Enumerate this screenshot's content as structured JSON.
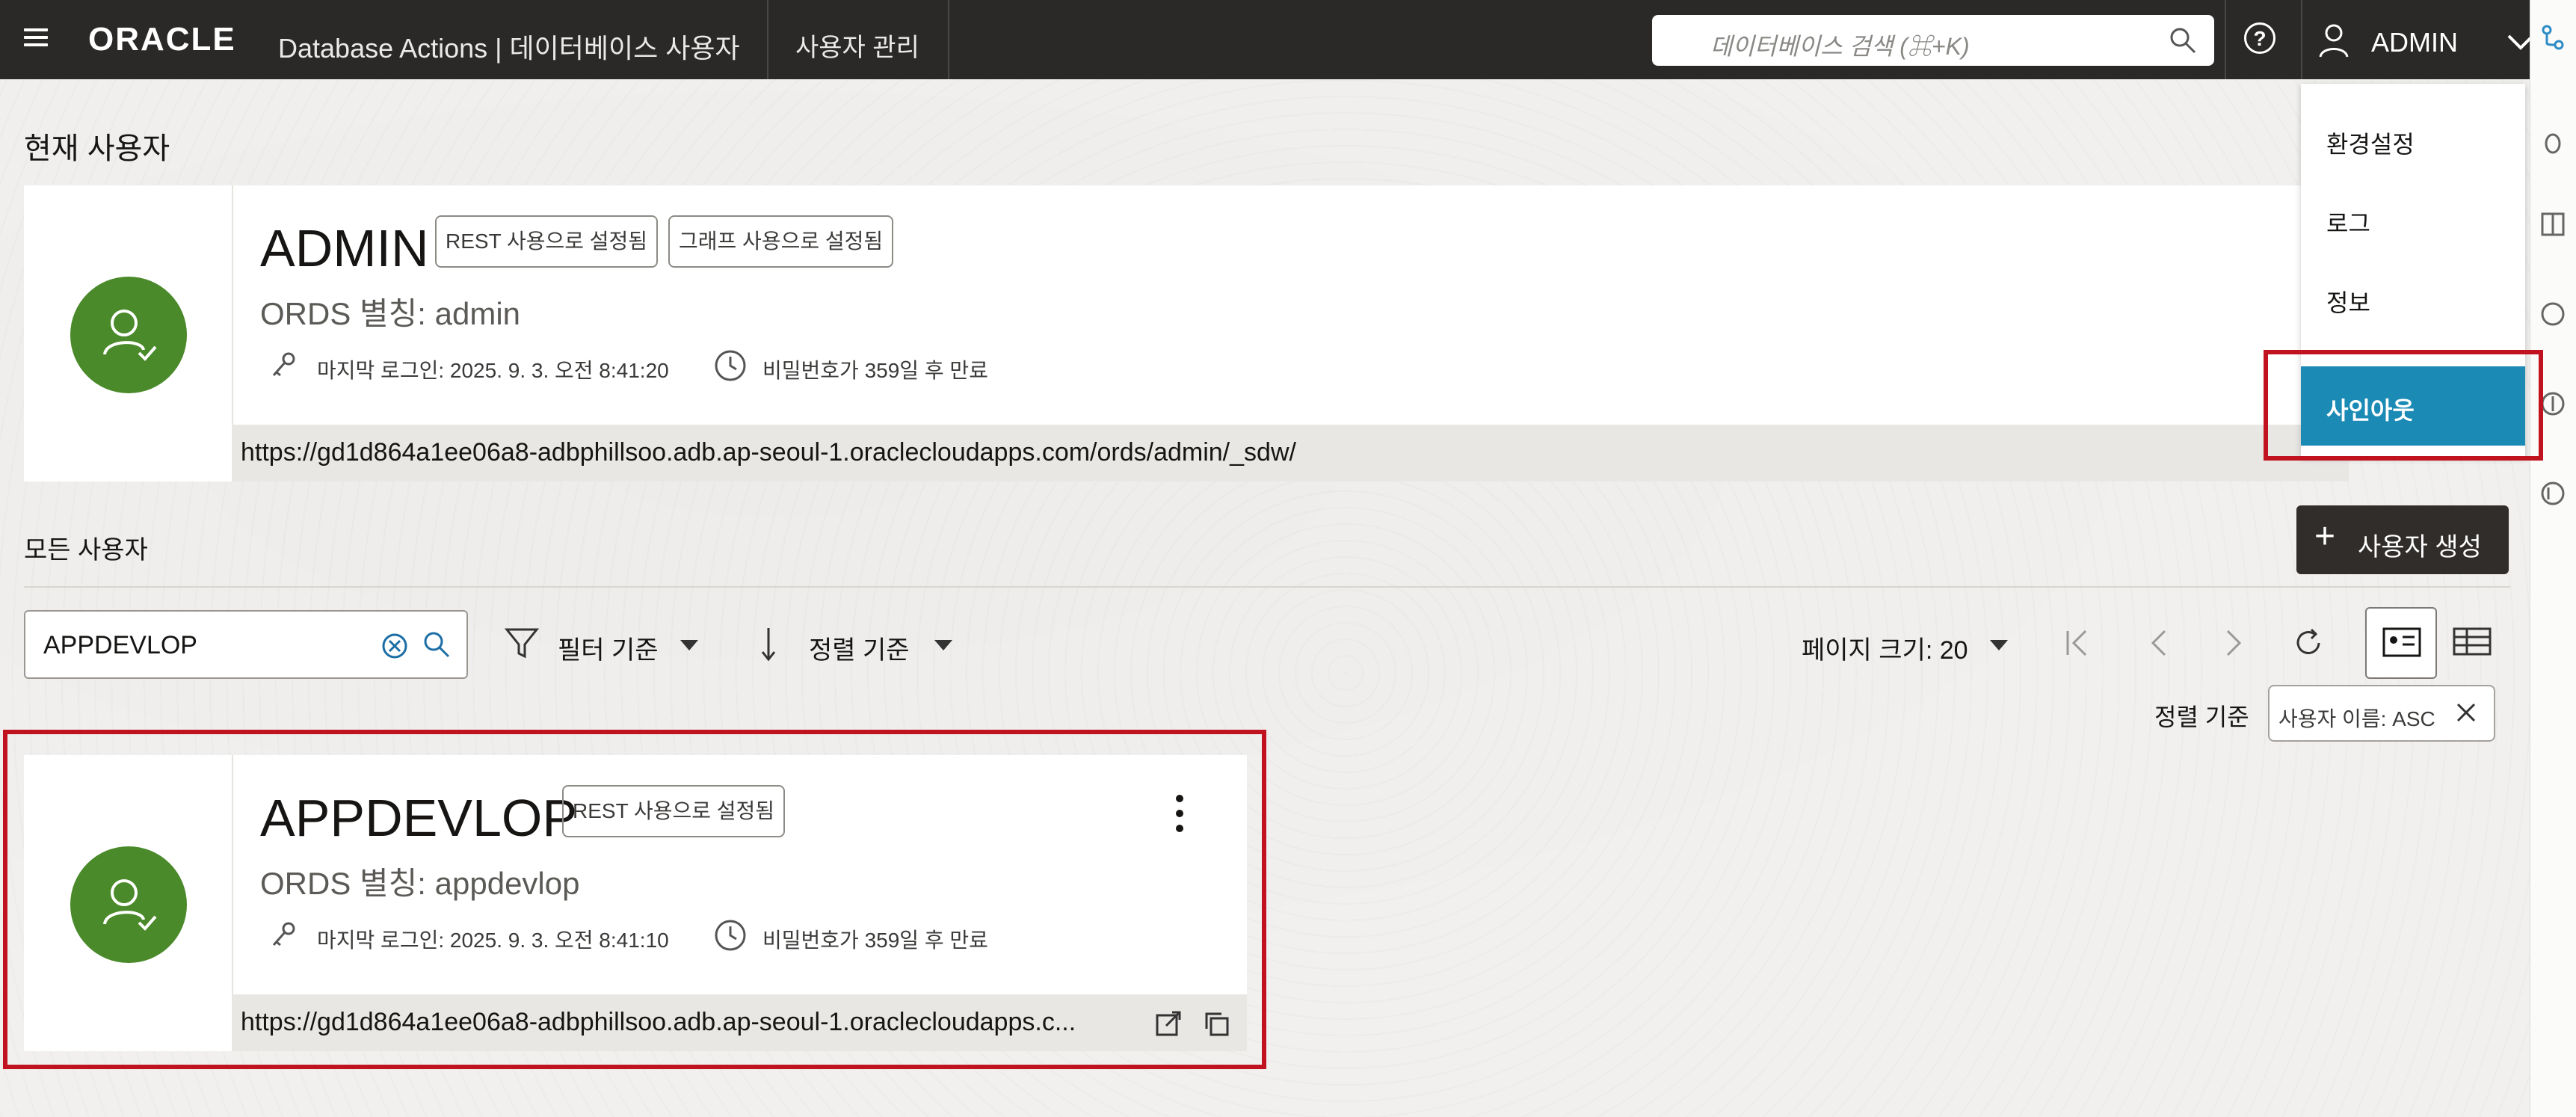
{
  "topbar": {
    "brand": "ORACLE",
    "product": "Database Actions |  데이터베이스 사용자",
    "tab": "사용자 관리",
    "search_placeholder": "데이터베이스 검색 (⌘+K)",
    "help_label": "?",
    "user_name": "ADMIN"
  },
  "user_menu": {
    "items": [
      "환경설정",
      "로그",
      "정보"
    ],
    "signout": "사인아웃"
  },
  "current_user": {
    "section_title": "현재 사용자",
    "name": "ADMIN",
    "badges": [
      "REST 사용으로 설정됨",
      "그래프 사용으로 설정됨"
    ],
    "alias": "ORDS 별칭: admin",
    "last_login": "마지막 로그인: 2025. 9. 3. 오전 8:41:20",
    "password_expiry": "비밀번호가 359일 후 만료",
    "url": "https://gd1d864a1ee06a8-adbphillsoo.adb.ap-seoul-1.oraclecloudapps.com/ords/admin/_sdw/"
  },
  "all_users": {
    "section_title": "모든 사용자",
    "create_button": "사용자 생성",
    "filter_value": "APPDEVLOP",
    "filter_by": "필터 기준",
    "sort_by": "정렬 기준",
    "page_size": "페이지 크기: 20",
    "sort_label": "정렬 기준",
    "sort_chip": "사용자 이름: ASC"
  },
  "user_card": {
    "name": "APPDEVLOP",
    "badge": "REST 사용으로 설정됨",
    "alias": "ORDS 별칭: appdevlop",
    "last_login": "마지막 로그인: 2025. 9. 3. 오전 8:41:10",
    "password_expiry": "비밀번호가 359일 후 만료",
    "url": "https://gd1d864a1ee06a8-adbphillsoo.adb.ap-seoul-1.oraclecloudapps.c..."
  },
  "colors": {
    "topbar": "#2b2927",
    "avatar_green": "#4a8a2a",
    "signout_teal": "#1b8bb5",
    "highlight_red": "#c1121f"
  },
  "icons": [
    "hamburger-menu-icon",
    "search-icon",
    "help-icon",
    "user-icon",
    "chevron-down-icon",
    "key-icon",
    "clock-icon",
    "clear-icon",
    "filter-icon",
    "sort-icon",
    "first-page-icon",
    "prev-page-icon",
    "next-page-icon",
    "refresh-icon",
    "card-view-icon",
    "table-view-icon",
    "close-icon",
    "kebab-menu-icon",
    "open-external-icon",
    "copy-icon",
    "plus-icon"
  ]
}
